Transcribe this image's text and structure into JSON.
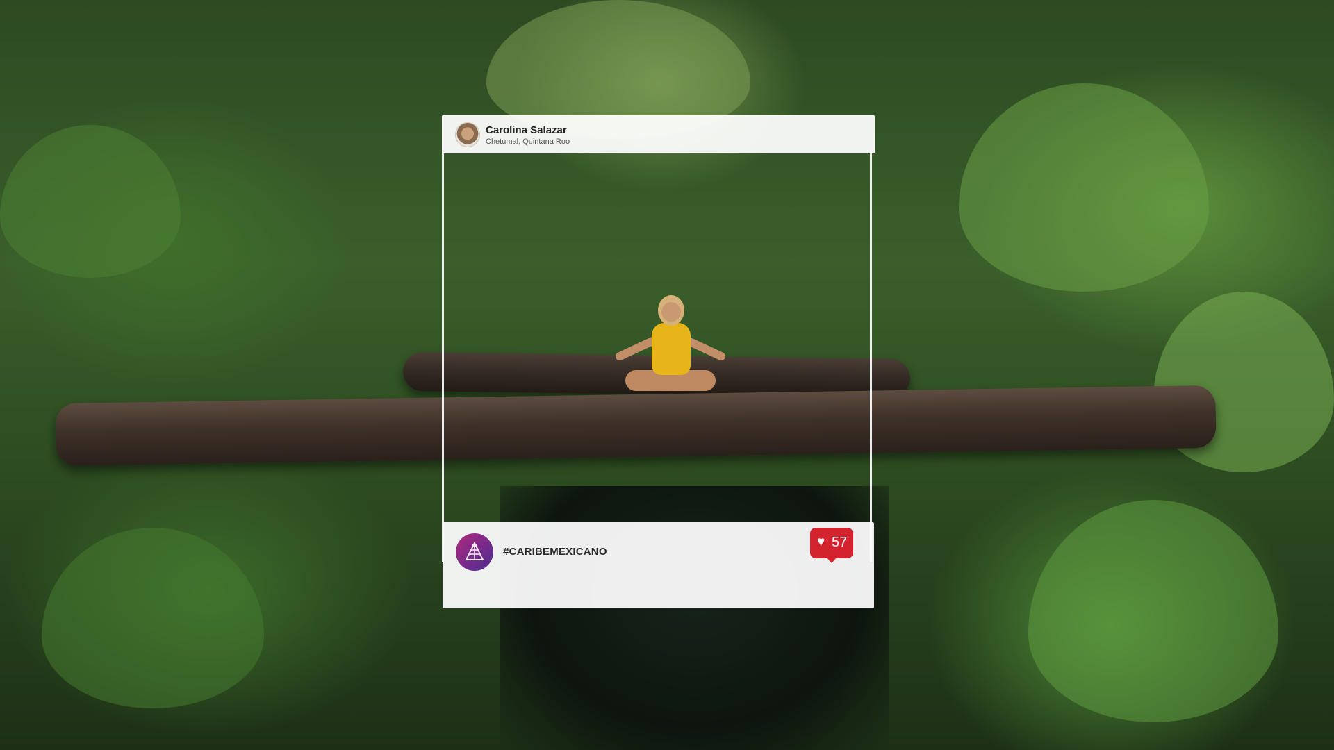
{
  "post": {
    "user_name": "Carolina Salazar",
    "location": "Chetumal, Quintana Roo",
    "hashtag": "#CARIBEMEXICANO",
    "like_count": "57"
  },
  "icons": {
    "avatar": "user-avatar",
    "brand": "pyramid-logo-icon",
    "like": "heart-icon"
  },
  "colors": {
    "like_badge": "#d3232f",
    "brand_gradient_start": "#b02a7a",
    "brand_gradient_end": "#4b2f8d"
  }
}
